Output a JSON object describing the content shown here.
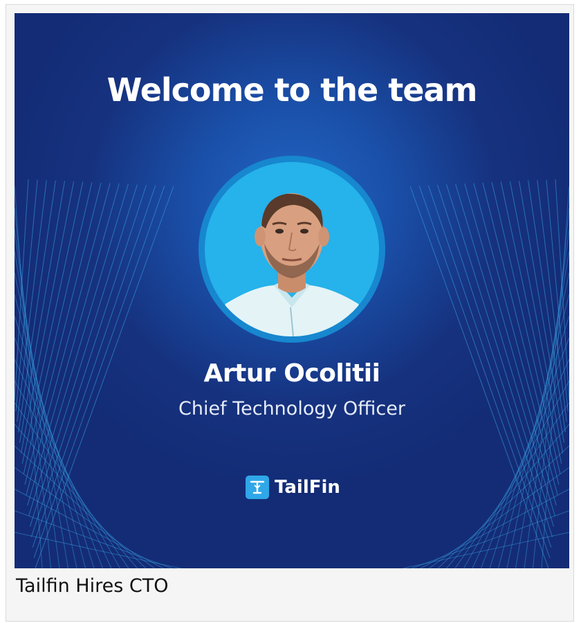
{
  "banner": {
    "headline": "Welcome to the team",
    "person_name": "Artur Ocolitii",
    "person_role": "Chief Technology Officer",
    "brand_name": "TailFin",
    "brand_icon": "tailfin-logo-icon",
    "colors": {
      "background_center": "#2166c4",
      "background_edge": "#142c76",
      "line_art": "#3aa6e8",
      "avatar_ring": "#1787cf",
      "avatar_bg": "#26b2ea",
      "brand_mark": "#2fa7e8"
    }
  },
  "caption": {
    "title": "Tailfin Hires CTO"
  }
}
